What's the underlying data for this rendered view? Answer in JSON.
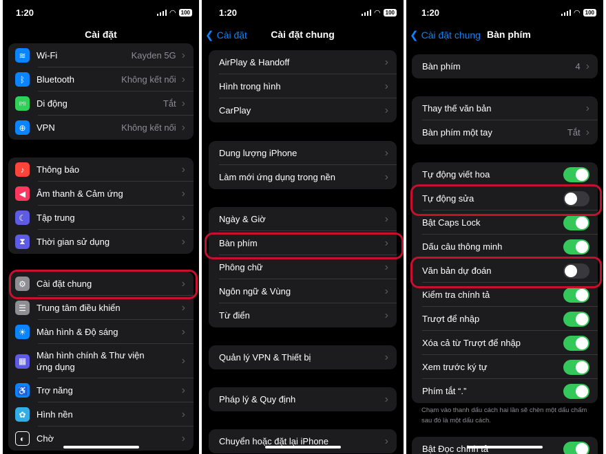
{
  "status": {
    "time": "1:20",
    "battery": "100"
  },
  "accent": "#0a84ff",
  "highlight_color": "#c8102e",
  "panel1": {
    "title": "Cài đặt",
    "groups": [
      [
        {
          "label": "Wi-Fi",
          "value": "Kayden 5G",
          "icon": "wifi-icon",
          "icon_glyph": "≋",
          "icon_color": "#0a84ff"
        },
        {
          "label": "Bluetooth",
          "value": "Không kết nối",
          "icon": "bluetooth-icon",
          "icon_glyph": "ᛒ",
          "icon_color": "#0a84ff"
        },
        {
          "label": "Di động",
          "value": "Tắt",
          "icon": "cellular-icon",
          "icon_glyph": "((•))",
          "icon_color": "#30d158"
        },
        {
          "label": "VPN",
          "value": "Không kết nối",
          "icon": "vpn-icon",
          "icon_glyph": "⊕",
          "icon_color": "#0a84ff"
        }
      ],
      [
        {
          "label": "Thông báo",
          "icon": "notification-bell-icon",
          "icon_glyph": "♪",
          "icon_color": "#ff453a"
        },
        {
          "label": "Âm thanh & Cảm ứng",
          "icon": "sound-speaker-icon",
          "icon_glyph": "◀",
          "icon_color": "#ff375f"
        },
        {
          "label": "Tập trung",
          "icon": "focus-moon-icon",
          "icon_glyph": "☾",
          "icon_color": "#5e5ce6"
        },
        {
          "label": "Thời gian sử dụng",
          "icon": "hourglass-icon",
          "icon_glyph": "⧗",
          "icon_color": "#5e5ce6"
        }
      ],
      [
        {
          "label": "Cài đặt chung",
          "icon": "gear-icon",
          "icon_glyph": "⚙",
          "icon_color": "#8e8e93"
        },
        {
          "label": "Trung tâm điều khiển",
          "icon": "control-center-icon",
          "icon_glyph": "☰",
          "icon_color": "#8e8e93"
        },
        {
          "label": "Màn hình & Độ sáng",
          "icon": "brightness-sun-icon",
          "icon_glyph": "☀",
          "icon_color": "#0a84ff"
        },
        {
          "label": "Màn hình chính & Thư viện ứng dụng",
          "icon": "home-screen-grid-icon",
          "icon_glyph": "▦",
          "icon_color": "#5e5ce6",
          "tall": true
        },
        {
          "label": "Trợ năng",
          "icon": "accessibility-icon",
          "icon_glyph": "♿",
          "icon_color": "#0a84ff"
        },
        {
          "label": "Hình nền",
          "icon": "wallpaper-flower-icon",
          "icon_glyph": "✿",
          "icon_color": "#32ade6"
        },
        {
          "label": "Chờ",
          "icon": "standby-icon",
          "icon_glyph": "◐",
          "icon_color": "#1c1c1e"
        }
      ]
    ]
  },
  "panel2": {
    "back": "Cài đặt",
    "title": "Cài đặt chung",
    "groups": [
      [
        {
          "label": "AirPlay & Handoff"
        },
        {
          "label": "Hình trong hình"
        },
        {
          "label": "CarPlay"
        }
      ],
      [
        {
          "label": "Dung lượng iPhone"
        },
        {
          "label": "Làm mới ứng dụng trong nền"
        }
      ],
      [
        {
          "label": "Ngày & Giờ"
        },
        {
          "label": "Bàn phím"
        },
        {
          "label": "Phông chữ"
        },
        {
          "label": "Ngôn ngữ & Vùng"
        },
        {
          "label": "Từ điển"
        }
      ],
      [
        {
          "label": "Quản lý VPN & Thiết bị"
        }
      ],
      [
        {
          "label": "Pháp lý & Quy định"
        }
      ],
      [
        {
          "label": "Chuyển hoặc đặt lại iPhone"
        }
      ]
    ]
  },
  "panel3": {
    "back": "Cài đặt chung",
    "title": "Bàn phím",
    "groups": [
      [
        {
          "label": "Bàn phím",
          "value": "4",
          "type": "link"
        }
      ],
      [
        {
          "label": "Thay thế văn bản",
          "type": "link"
        },
        {
          "label": "Bàn phím một tay",
          "value": "Tắt",
          "type": "link"
        }
      ],
      [
        {
          "label": "Tự động viết hoa",
          "type": "toggle",
          "on": true
        },
        {
          "label": "Tự động sửa",
          "type": "toggle",
          "on": false
        },
        {
          "label": "Bật Caps Lock",
          "type": "toggle",
          "on": true
        },
        {
          "label": "Dấu câu thông minh",
          "type": "toggle",
          "on": true
        },
        {
          "label": "Văn bản dự đoán",
          "type": "toggle",
          "on": false
        },
        {
          "label": "Kiểm tra chính tả",
          "type": "toggle",
          "on": true
        },
        {
          "label": "Trượt để nhập",
          "type": "toggle",
          "on": true
        },
        {
          "label": "Xóa cả từ Trượt để nhập",
          "type": "toggle",
          "on": true
        },
        {
          "label": "Xem trước ký tự",
          "type": "toggle",
          "on": true
        },
        {
          "label": "Phím tắt “.”",
          "type": "toggle",
          "on": true
        }
      ],
      [
        {
          "label": "Bật Đọc chính tả",
          "type": "toggle",
          "on": true
        }
      ]
    ],
    "footnote": "Chạm vào thanh dấu cách hai lần sẽ chèn một dấu chấm sau đó là một dấu cách."
  }
}
